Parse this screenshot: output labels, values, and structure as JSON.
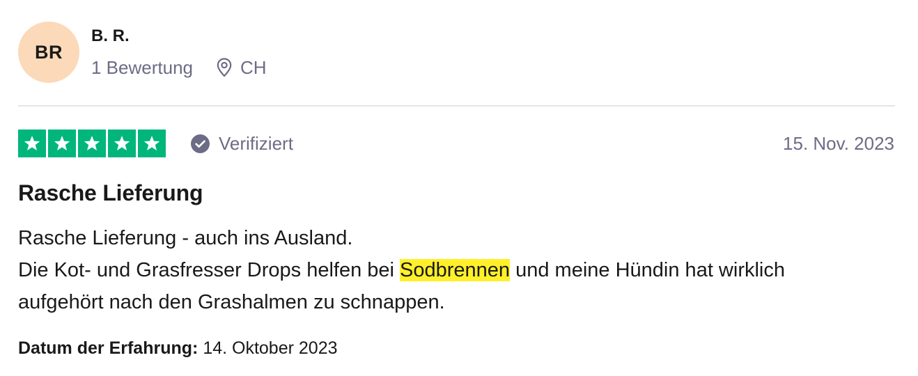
{
  "consumer": {
    "initials": "BR",
    "name": "B. R.",
    "review_count": "1 Bewertung",
    "country": "CH"
  },
  "review": {
    "rating": 5,
    "verified_label": "Verifiziert",
    "date": "15. Nov. 2023",
    "title": "Rasche Lieferung",
    "body": {
      "line1": "Rasche Lieferung - auch ins Ausland.",
      "line2_before": "Die Kot- und Grasfresser Drops helfen bei ",
      "line2_highlight": "Sodbrennen",
      "line2_after": " und meine Hündin hat wirklich",
      "line3": "aufgehört nach den Grashalmen zu schnappen."
    },
    "experience_label": "Datum der Erfahrung:",
    "experience_date": "14. Oktober 2023"
  },
  "colors": {
    "star_green": "#00b67a",
    "avatar_bg": "#fcd9b8",
    "highlight": "#fff02a",
    "muted_text": "#6c6c85"
  },
  "icons": {
    "location": "location-pin-icon",
    "verified": "verified-check-icon",
    "star": "star-icon"
  }
}
